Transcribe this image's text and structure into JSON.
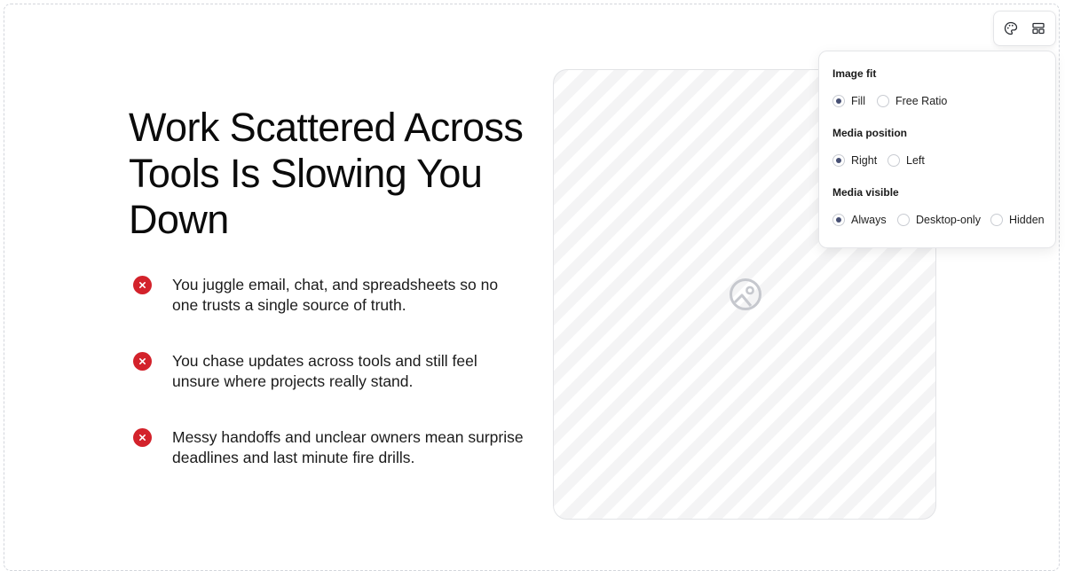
{
  "hero": {
    "headline": "Work Scattered Across Tools Is Slowing You Down",
    "points": [
      {
        "icon": "x-circle-icon",
        "text": "You juggle email, chat, and spreadsheets so no one trusts a single source of truth."
      },
      {
        "icon": "x-circle-icon",
        "text": "You chase updates across tools and still feel unsure where projects really stand."
      },
      {
        "icon": "x-circle-icon",
        "text": "Messy handoffs and unclear owners mean surprise deadlines and last minute fire drills."
      }
    ]
  },
  "media": {
    "placeholder_icon": "image-placeholder-icon"
  },
  "toolbar": {
    "buttons": [
      {
        "icon": "palette-icon"
      },
      {
        "icon": "layout-icon"
      }
    ]
  },
  "settings_panel": {
    "image_fit": {
      "label": "Image fit",
      "options": [
        "Fill",
        "Free Ratio"
      ],
      "selected": "Fill"
    },
    "media_position": {
      "label": "Media position",
      "options": [
        "Right",
        "Left"
      ],
      "selected": "Right"
    },
    "media_visible": {
      "label": "Media visible",
      "options": [
        "Always",
        "Desktop-only",
        "Hidden"
      ],
      "selected": "Always"
    }
  },
  "colors": {
    "error_red": "#d3222b",
    "radio_selected": "#475074",
    "stripe": "#f4f4f5"
  }
}
